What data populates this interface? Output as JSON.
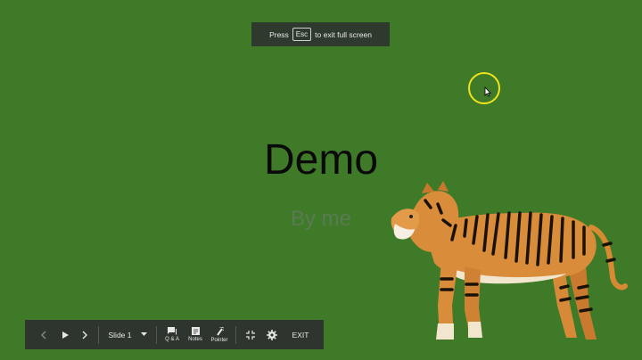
{
  "fullscreen_banner": {
    "press": "Press",
    "key": "Esc",
    "suffix": "to exit full screen"
  },
  "slide": {
    "title": "Demo",
    "subtitle": "By me",
    "background": "#3f7a29"
  },
  "toolbar": {
    "slide_label": "Slide 1",
    "qa_label": "Q & A",
    "notes_label": "Notes",
    "pointer_label": "Pointer",
    "exit_label": "EXIT"
  }
}
